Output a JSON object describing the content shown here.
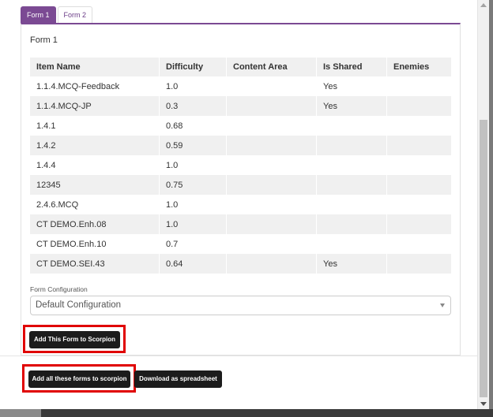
{
  "tabs": [
    {
      "label": "Form 1",
      "active": true
    },
    {
      "label": "Form 2",
      "active": false
    }
  ],
  "panel": {
    "title": "Form 1"
  },
  "table": {
    "headers": [
      "Item Name",
      "Difficulty",
      "Content Area",
      "Is Shared",
      "Enemies"
    ],
    "rows": [
      [
        "1.1.4.MCQ-Feedback",
        "1.0",
        "",
        "Yes",
        ""
      ],
      [
        "1.1.4.MCQ-JP",
        "0.3",
        "",
        "Yes",
        ""
      ],
      [
        "1.4.1",
        "0.68",
        "",
        "",
        ""
      ],
      [
        "1.4.2",
        "0.59",
        "",
        "",
        ""
      ],
      [
        "1.4.4",
        "1.0",
        "",
        "",
        ""
      ],
      [
        "12345",
        "0.75",
        "",
        "",
        ""
      ],
      [
        "2.4.6.MCQ",
        "1.0",
        "",
        "",
        ""
      ],
      [
        "CT DEMO.Enh.08",
        "1.0",
        "",
        "",
        ""
      ],
      [
        "CT DEMO.Enh.10",
        "0.7",
        "",
        "",
        ""
      ],
      [
        "CT DEMO.SEI.43",
        "0.64",
        "",
        "Yes",
        ""
      ]
    ]
  },
  "config": {
    "label": "Form Configuration",
    "value": "Default Configuration"
  },
  "buttons": {
    "add_this_form": "Add This Form to Scorpion",
    "add_all_forms": "Add all these forms to scorpion",
    "download": "Download as spreadsheet"
  },
  "colors": {
    "accent": "#7b4a93",
    "highlight": "#e00000",
    "button": "#1c1c1c"
  }
}
